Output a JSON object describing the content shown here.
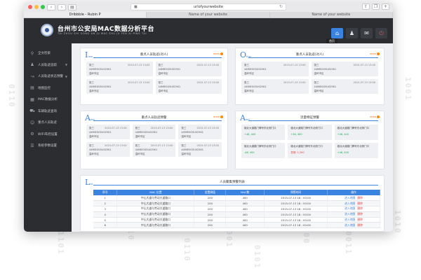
{
  "browser": {
    "url": "urlofyourwebsite",
    "tabs": [
      {
        "label": "Dribbble - Rubin P"
      },
      {
        "label": "Name of your website"
      },
      {
        "label": "Name of your website"
      }
    ]
  },
  "app": {
    "title": "台州市公安局MAC数据分析平台",
    "subtitle": "TAI ZHOU SHI GONG AN JU MAC SHU JU FEN XI PING TAI",
    "tooltip": "首页"
  },
  "sidebar": {
    "items": [
      {
        "icon": "search-icon",
        "label": "全文检索"
      },
      {
        "icon": "person-icon",
        "label": "人员轨迹追踪",
        "arrow": true
      },
      {
        "icon": "chart-icon",
        "label": "人员轨迹状态预警",
        "arrow": true
      },
      {
        "icon": "map-icon",
        "label": "地图监控"
      },
      {
        "icon": "list-icon",
        "label": "MAC数据分析"
      },
      {
        "icon": "car-icon",
        "label": "车辆轨迹查询"
      },
      {
        "icon": "user-icon",
        "label": "重点人员轨迹"
      },
      {
        "icon": "gear-icon",
        "label": "WIFI布控设置"
      },
      {
        "icon": "setting-icon",
        "label": "系统参数设置"
      }
    ]
  },
  "panels": {
    "p1": {
      "letter": "I",
      "letter_sub": "tem",
      "title": "重点人员轨迹(对人)",
      "more": "more"
    },
    "p2": {
      "letter": "O",
      "letter_sub": "ther",
      "title": "重点人员轨迹(对人)",
      "more": "more"
    },
    "p3": {
      "letter": "A",
      "letter_sub": "lert",
      "title": "重点人员轨迹预警",
      "more": "more"
    },
    "p4": {
      "letter": "A",
      "letter_sub": "lert",
      "title": "流量特征预警",
      "more": "more"
    },
    "p5": {
      "letter": "L",
      "letter_sub": "ist",
      "title": "人员聚集预警列表",
      "more": ""
    }
  },
  "cards_common": {
    "name": "张三",
    "time": "2015-07-13 13:00",
    "mac": "44MIE0G5U025K1",
    "loc": "温岭市区"
  },
  "alert_cards": [
    {
      "addr": "椒北大道路门牌号东北侧门口",
      "value": "+46, 400",
      "bad": false
    },
    {
      "addr": "椒北大道路门牌号东北侧门口",
      "value": "+46, 400",
      "bad": false
    },
    {
      "addr": "椒北大道路门牌号东北侧门口",
      "value": "+46, 400",
      "bad": false
    },
    {
      "addr": "椒北大道路门牌号东北侧门口",
      "value": "-46, 400",
      "bad": false
    },
    {
      "addr": "椒北大道路门牌号东北侧门口",
      "value": "异常: 1,200",
      "bad": true
    },
    {
      "addr": "椒北大道路门牌号东北侧门口",
      "value": "+46, 400",
      "bad": false
    }
  ],
  "table": {
    "headers": [
      "序号",
      "MAC 位置",
      "设置阈值",
      "MAC数",
      "预警时间",
      "操作"
    ],
    "rows": [
      {
        "no": "1",
        "loc": "中山大道与劳动大道路口",
        "threshold": "200",
        "count": "400",
        "time": "2015-07-13 18 : 00:00"
      },
      {
        "no": "2",
        "loc": "中山大道与劳动大道路口",
        "threshold": "200",
        "count": "400",
        "time": "2015-07-13 18 : 00:00"
      },
      {
        "no": "3",
        "loc": "中山大道与劳动大道路口",
        "threshold": "200",
        "count": "400",
        "time": "2015-07-13 18 : 00:00"
      },
      {
        "no": "4",
        "loc": "中山大道与劳动大道路口",
        "threshold": "200",
        "count": "400",
        "time": "2015-07-13 18 : 00:00"
      },
      {
        "no": "5",
        "loc": "中山大道与劳动大道路口",
        "threshold": "200",
        "count": "400",
        "time": "2015-07-13 18 : 00:00"
      },
      {
        "no": "6",
        "loc": "中山大道与劳动大道路口",
        "threshold": "200",
        "count": "400",
        "time": "2015-07-13 18 : 00:00"
      }
    ],
    "op_detail": "进入地图",
    "op_delete": "删除"
  }
}
